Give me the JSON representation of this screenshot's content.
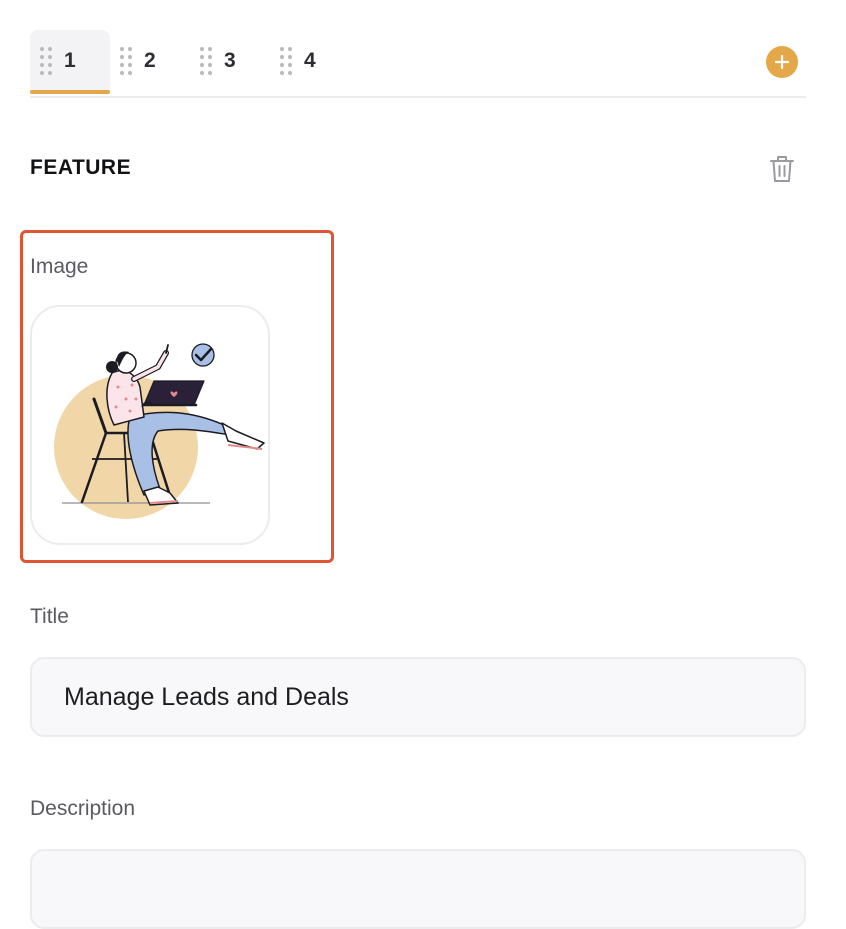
{
  "tabs": [
    {
      "label": "1",
      "active": true
    },
    {
      "label": "2",
      "active": false
    },
    {
      "label": "3",
      "active": false
    },
    {
      "label": "4",
      "active": false
    }
  ],
  "icons": {
    "add": "plus-circle-icon",
    "drag": "drag-handle-icon",
    "delete": "trash-icon"
  },
  "section": {
    "title": "FEATURE"
  },
  "fields": {
    "image": {
      "label": "Image",
      "illustration": "person-with-laptop-illustration"
    },
    "title": {
      "label": "Title",
      "value": "Manage Leads and Deals"
    },
    "description": {
      "label": "Description",
      "value": ""
    }
  },
  "colors": {
    "accent": "#e4a84a",
    "highlight_border": "#df5534",
    "input_background": "#f8f8fa"
  }
}
